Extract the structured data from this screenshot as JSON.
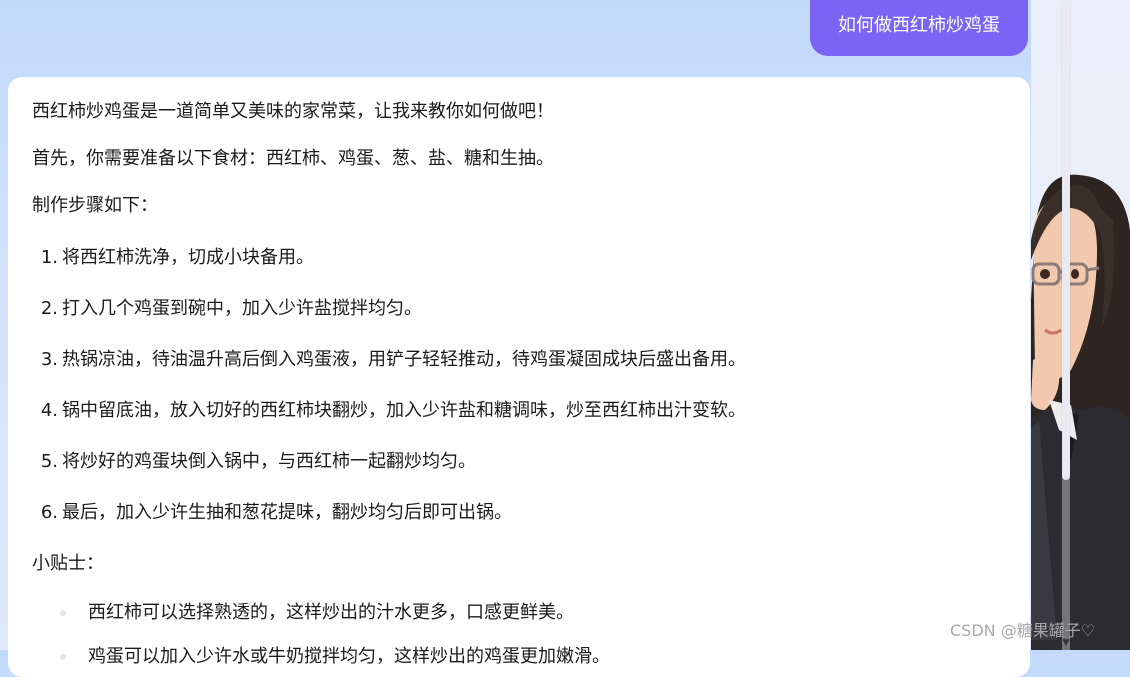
{
  "chat": {
    "user_message": "如何做西红柿炒鸡蛋",
    "reply": {
      "intro": "西红柿炒鸡蛋是一道简单又美味的家常菜，让我来教你如何做吧！",
      "ingredients": "首先，你需要准备以下食材：西红柿、鸡蛋、葱、盐、糖和生抽。",
      "steps_title": "制作步骤如下：",
      "steps": [
        {
          "num": "1.",
          "text": "将西红柿洗净，切成小块备用。"
        },
        {
          "num": "2.",
          "text": "打入几个鸡蛋到碗中，加入少许盐搅拌均匀。"
        },
        {
          "num": "3.",
          "text": "热锅凉油，待油温升高后倒入鸡蛋液，用铲子轻轻推动，待鸡蛋凝固成块后盛出备用。"
        },
        {
          "num": "4.",
          "text": "锅中留底油，放入切好的西红柿块翻炒，加入少许盐和糖调味，炒至西红柿出汁变软。"
        },
        {
          "num": "5.",
          "text": "将炒好的鸡蛋块倒入锅中，与西红柿一起翻炒均匀。"
        },
        {
          "num": "6.",
          "text": "最后，加入少许生抽和葱花提味，翻炒均匀后即可出锅。"
        }
      ],
      "tips_title": "小贴士：",
      "tips": [
        "西红柿可以选择熟透的，这样炒出的汁水更多，口感更鲜美。",
        "鸡蛋可以加入少许水或牛奶搅拌均匀，这样炒出的鸡蛋更加嫩滑。"
      ]
    }
  },
  "watermark": "CSDN @糖果罐子♡",
  "colors": {
    "user_bubble": "#7a63f5",
    "background": "#c3d9fb",
    "card": "#ffffff"
  },
  "icons": {
    "scroll_down": "▼",
    "avatar": "assistant-avatar-illustration"
  }
}
